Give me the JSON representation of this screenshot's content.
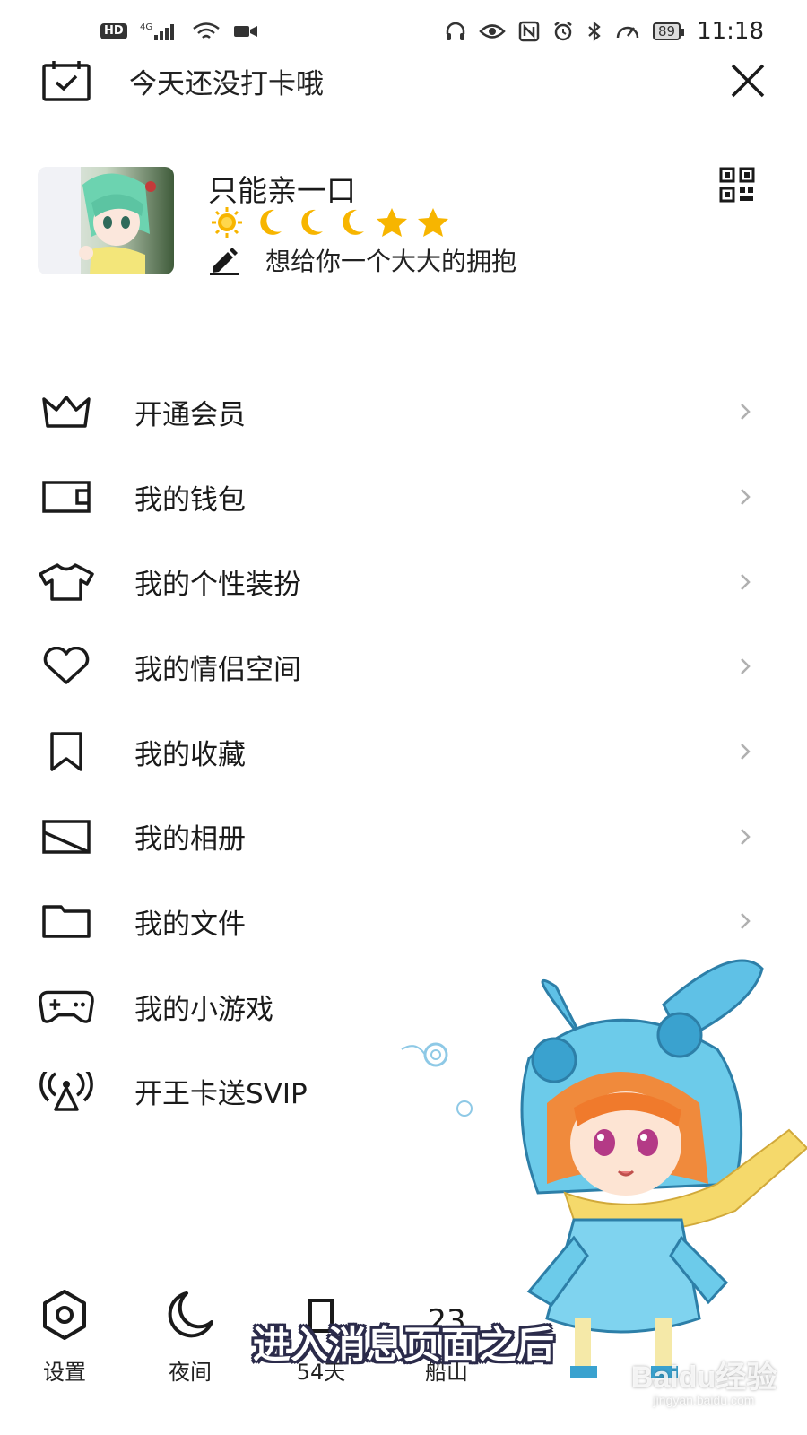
{
  "status_bar": {
    "hd": "HD",
    "network": "4G",
    "battery": "89",
    "time": "11:18"
  },
  "checkin": {
    "label": "今天还没打卡哦"
  },
  "profile": {
    "nickname": "只能亲一口",
    "level_icons": [
      "sun",
      "moon",
      "moon",
      "moon",
      "star",
      "star"
    ],
    "signature": "想给你一个大大的拥抱"
  },
  "menu": {
    "items": [
      {
        "label": "开通会员",
        "icon": "crown-icon"
      },
      {
        "label": "我的钱包",
        "icon": "wallet-icon"
      },
      {
        "label": "我的个性装扮",
        "icon": "tshirt-icon"
      },
      {
        "label": "我的情侣空间",
        "icon": "heart-icon"
      },
      {
        "label": "我的收藏",
        "icon": "bookmark-icon"
      },
      {
        "label": "我的相册",
        "icon": "photo-icon"
      },
      {
        "label": "我的文件",
        "icon": "folder-icon"
      },
      {
        "label": "我的小游戏",
        "icon": "gamepad-icon"
      },
      {
        "label": "开王卡送SVIP",
        "icon": "signal-tower-icon"
      }
    ]
  },
  "bottom_bar": {
    "settings_label": "设置",
    "night_label": "夜间",
    "days_label": "54天",
    "weather_label": "船山"
  },
  "overlay": {
    "subtitle": "进入消息页面之后",
    "watermark_brand": "Baidu经验",
    "watermark_url": "jingyan.baidu.com"
  },
  "colors": {
    "background": "#ffffff",
    "text": "#1a1a1a",
    "chevron": "#b0b0b0",
    "level_gold": "#f7b500"
  }
}
